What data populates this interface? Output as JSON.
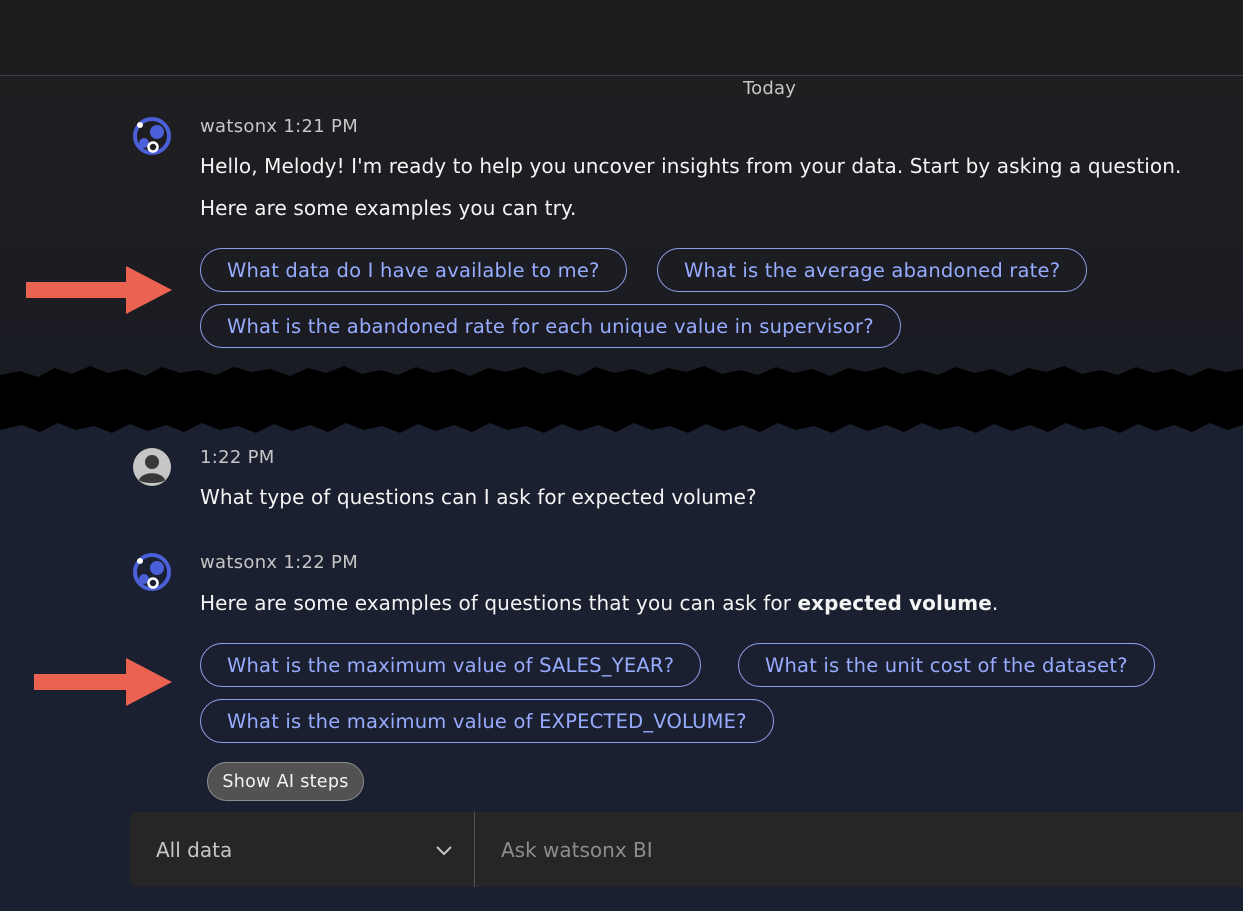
{
  "date_divider": "Today",
  "conversation": {
    "message1": {
      "sender": "watsonx",
      "time": "1:21 PM",
      "line1": "Hello, Melody! I'm ready to help you uncover insights from your data. Start by asking a question.",
      "line2": "Here are some examples you can try.",
      "suggestions": [
        "What data do I have available to me?",
        "What is the average abandoned rate?",
        "What is the abandoned rate for each unique value in supervisor?"
      ]
    },
    "message2": {
      "time": "1:22 PM",
      "text": "What type of questions can I ask for expected volume?"
    },
    "message3": {
      "sender": "watsonx",
      "time": "1:22 PM",
      "text_before": "Here are some examples of questions that you can ask for ",
      "text_bold": "expected volume",
      "text_after": ".",
      "suggestions": [
        "What is the maximum value of SALES_YEAR?",
        "What is the unit cost of the dataset?",
        "What is the maximum value of EXPECTED_VOLUME?"
      ],
      "steps_button": "Show AI steps"
    }
  },
  "input_bar": {
    "dataset": "All data",
    "placeholder": "Ask watsonx BI"
  },
  "colors": {
    "chip_border": "#8e9fe8",
    "chip_text": "#97abff",
    "arrow": "#ec6250",
    "avatar_accent": "#4a5fd8"
  },
  "icons": [
    "watsonx-logo-icon",
    "user-avatar-icon",
    "chevron-down-icon",
    "arrow-right-icon"
  ]
}
